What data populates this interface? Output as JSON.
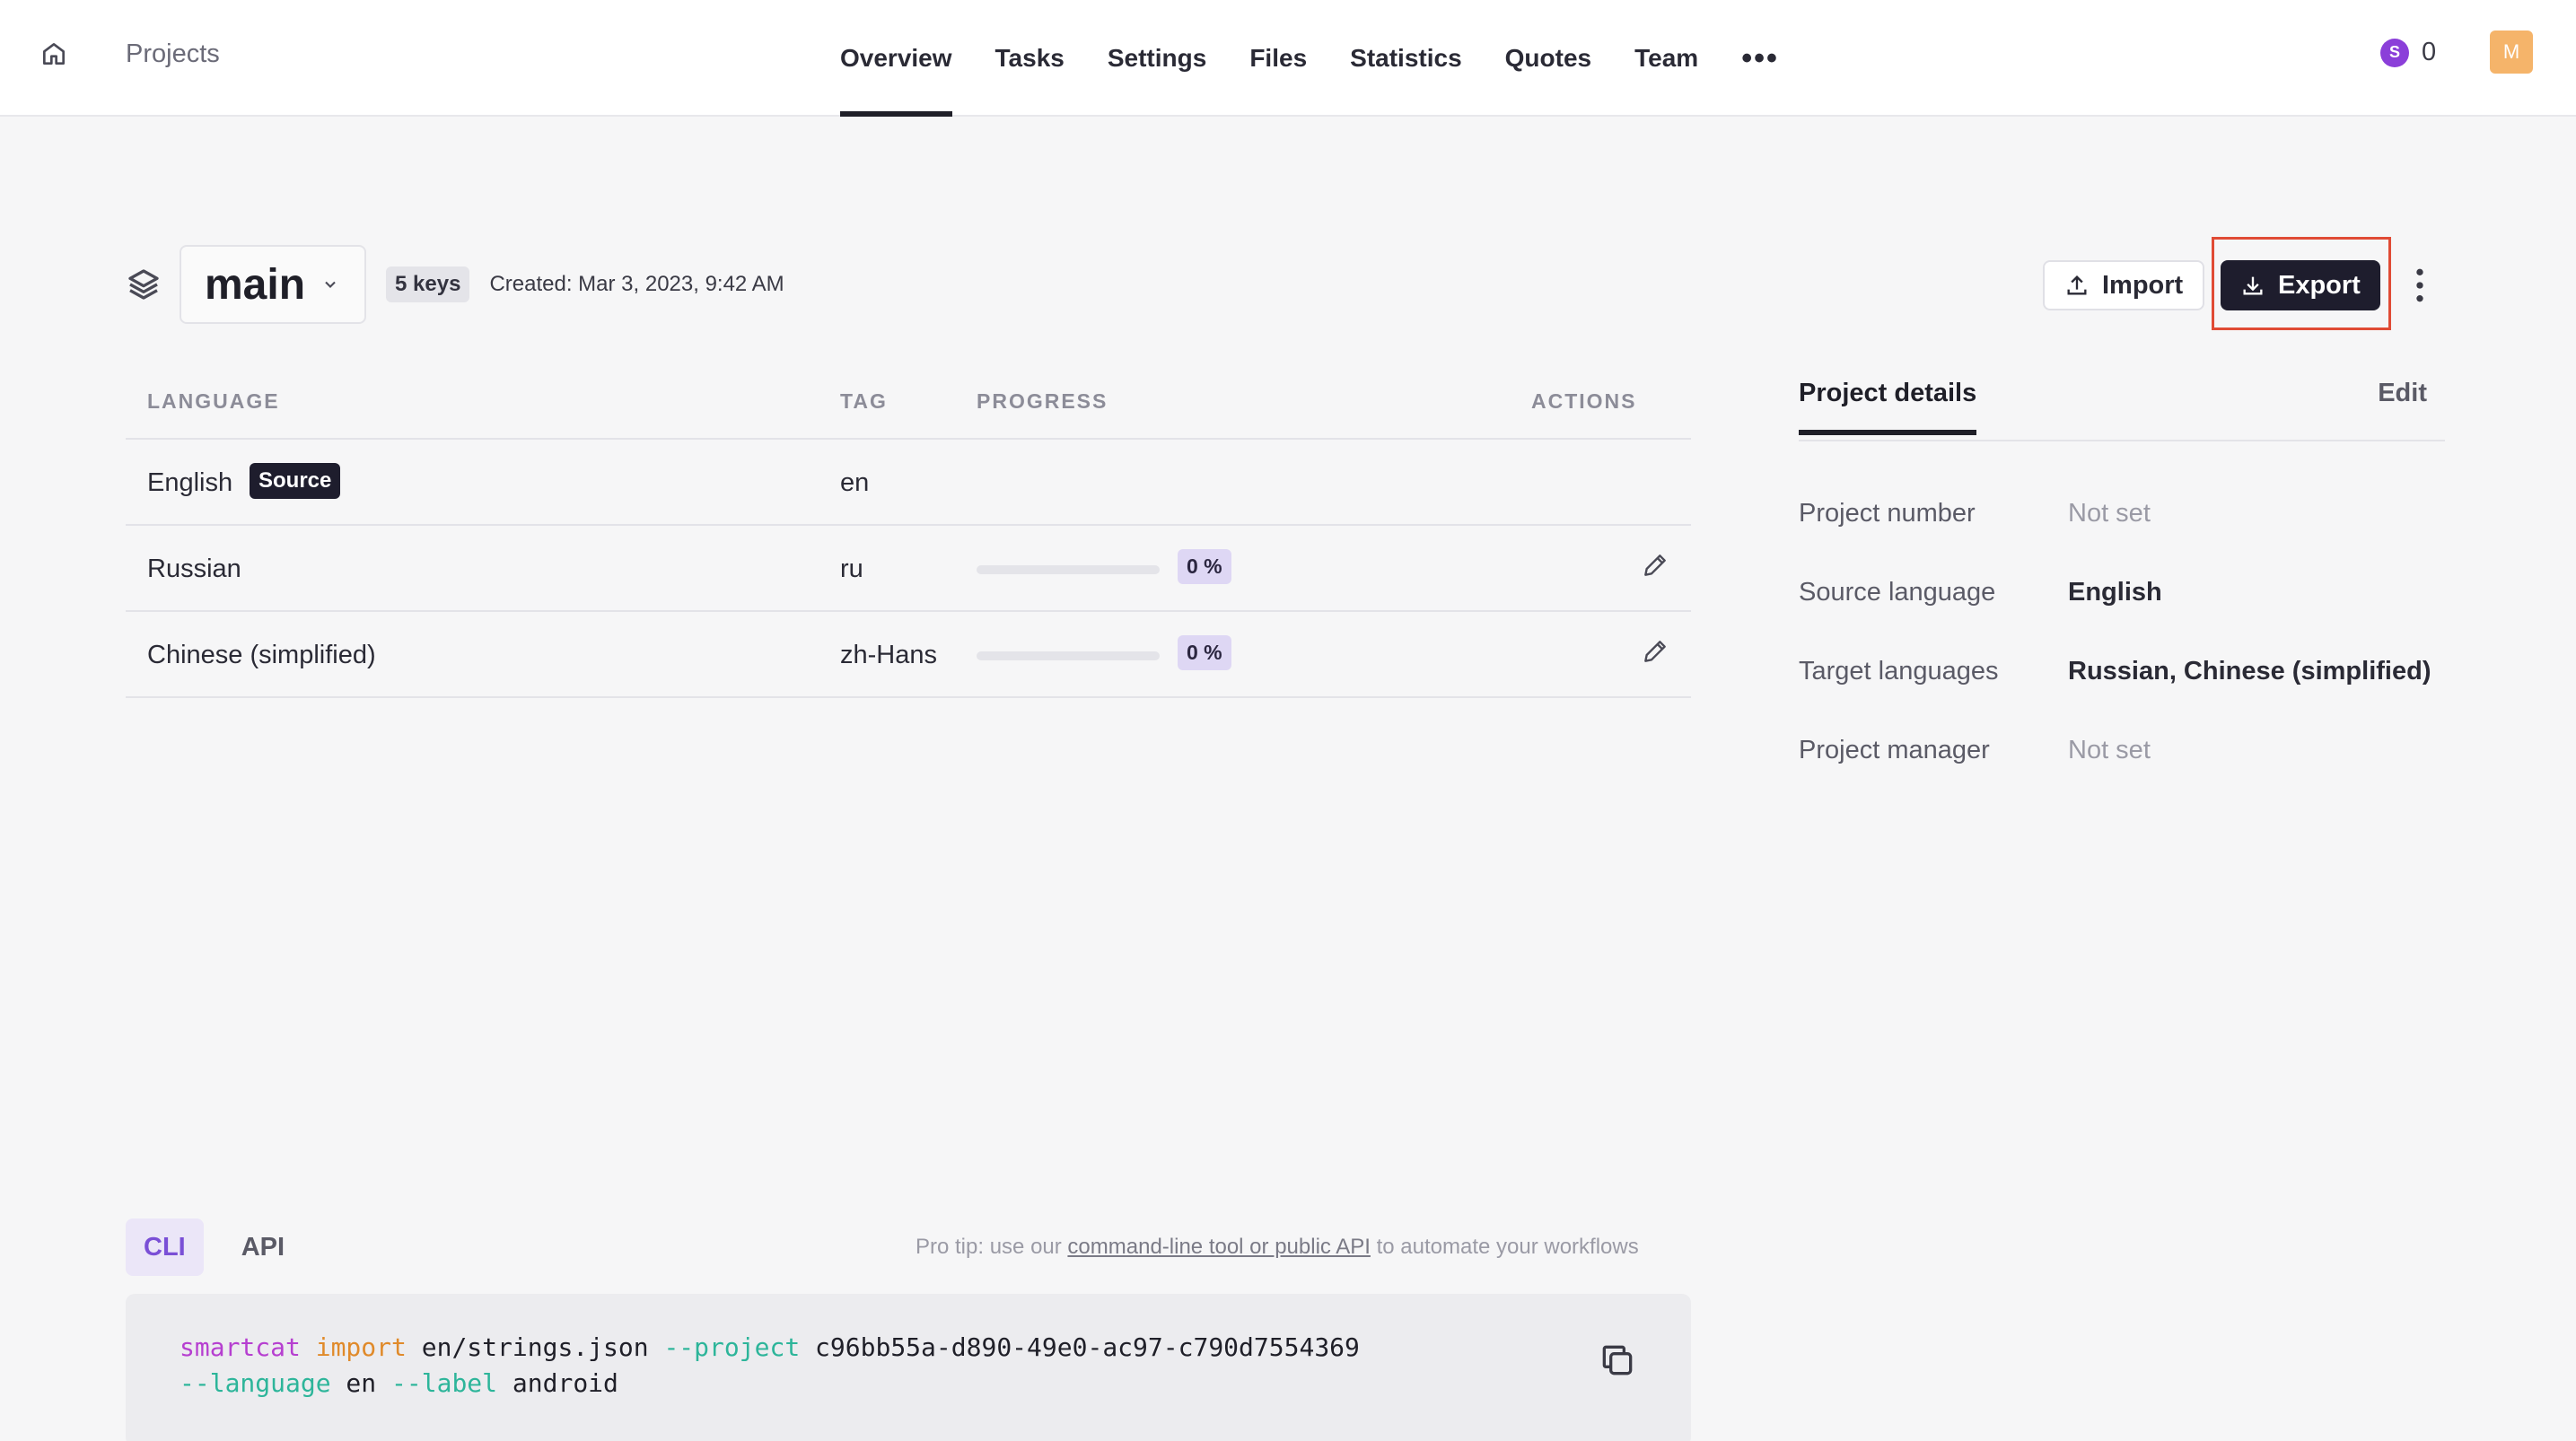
{
  "topbar": {
    "breadcrumb": "Projects",
    "nav": [
      {
        "label": "Overview",
        "active": true
      },
      {
        "label": "Tasks",
        "active": false
      },
      {
        "label": "Settings",
        "active": false
      },
      {
        "label": "Files",
        "active": false
      },
      {
        "label": "Statistics",
        "active": false
      },
      {
        "label": "Quotes",
        "active": false
      },
      {
        "label": "Team",
        "active": false
      }
    ],
    "more_label": "•••",
    "credit_icon_letter": "S",
    "credit_value": "0",
    "avatar_initial": "M"
  },
  "branch": {
    "name": "main",
    "keys": "5 keys",
    "created": "Created: Mar 3, 2023, 9:42 AM"
  },
  "actions": {
    "import_label": "Import",
    "export_label": "Export"
  },
  "languages_table": {
    "headers": {
      "language": "LANGUAGE",
      "tag": "TAG",
      "progress": "PROGRESS",
      "actions": "ACTIONS"
    },
    "rows": [
      {
        "language": "English",
        "badge": "Source",
        "tag": "en",
        "progress": null
      },
      {
        "language": "Russian",
        "tag": "ru",
        "progress": 0,
        "progress_label": "0 %"
      },
      {
        "language": "Chinese (simplified)",
        "tag": "zh-Hans",
        "progress": 0,
        "progress_label": "0 %"
      }
    ]
  },
  "project_details": {
    "title": "Project details",
    "edit_label": "Edit",
    "rows": [
      {
        "label": "Project number",
        "value": "Not set"
      },
      {
        "label": "Source language",
        "value": "English"
      },
      {
        "label": "Target languages",
        "value": "Russian, Chinese (simplified)"
      },
      {
        "label": "Project manager",
        "value": "Not set"
      }
    ]
  },
  "automation": {
    "tabs": [
      {
        "label": "CLI",
        "active": true
      },
      {
        "label": "API",
        "active": false
      }
    ],
    "protip_prefix": "Pro tip: use our ",
    "protip_link": "command-line tool or public API",
    "protip_suffix": " to automate your workflows",
    "code": {
      "cmd": "smartcat",
      "sub": "import",
      "file": " en/strings.json ",
      "flag_project": "--project",
      "project_id": " c96bb55a-d890-49e0-ac97-c790d7554369",
      "flag_language": "--language",
      "language": " en ",
      "flag_label": "--label",
      "label": " android"
    }
  },
  "colors": {
    "accent_dark": "#1e1d2d",
    "export_highlight": "#e04b35",
    "purple": "#7a4fd6",
    "avatar": "#f5b46a"
  }
}
